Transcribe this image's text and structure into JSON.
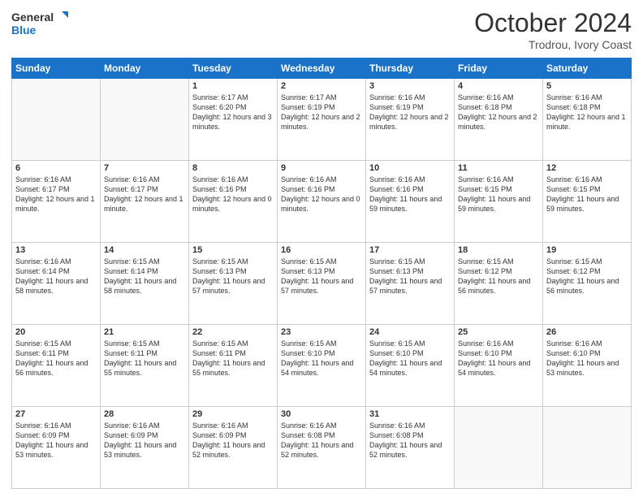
{
  "logo": {
    "line1": "General",
    "line2": "Blue"
  },
  "header": {
    "month": "October 2024",
    "location": "Trodrou, Ivory Coast"
  },
  "days_of_week": [
    "Sunday",
    "Monday",
    "Tuesday",
    "Wednesday",
    "Thursday",
    "Friday",
    "Saturday"
  ],
  "weeks": [
    [
      {
        "day": "",
        "empty": true
      },
      {
        "day": "",
        "empty": true
      },
      {
        "day": "1",
        "sunrise": "6:17 AM",
        "sunset": "6:20 PM",
        "daylight": "12 hours and 3 minutes."
      },
      {
        "day": "2",
        "sunrise": "6:17 AM",
        "sunset": "6:19 PM",
        "daylight": "12 hours and 2 minutes."
      },
      {
        "day": "3",
        "sunrise": "6:16 AM",
        "sunset": "6:19 PM",
        "daylight": "12 hours and 2 minutes."
      },
      {
        "day": "4",
        "sunrise": "6:16 AM",
        "sunset": "6:18 PM",
        "daylight": "12 hours and 2 minutes."
      },
      {
        "day": "5",
        "sunrise": "6:16 AM",
        "sunset": "6:18 PM",
        "daylight": "12 hours and 1 minute."
      }
    ],
    [
      {
        "day": "6",
        "sunrise": "6:16 AM",
        "sunset": "6:17 PM",
        "daylight": "12 hours and 1 minute."
      },
      {
        "day": "7",
        "sunrise": "6:16 AM",
        "sunset": "6:17 PM",
        "daylight": "12 hours and 1 minute."
      },
      {
        "day": "8",
        "sunrise": "6:16 AM",
        "sunset": "6:16 PM",
        "daylight": "12 hours and 0 minutes."
      },
      {
        "day": "9",
        "sunrise": "6:16 AM",
        "sunset": "6:16 PM",
        "daylight": "12 hours and 0 minutes."
      },
      {
        "day": "10",
        "sunrise": "6:16 AM",
        "sunset": "6:16 PM",
        "daylight": "11 hours and 59 minutes."
      },
      {
        "day": "11",
        "sunrise": "6:16 AM",
        "sunset": "6:15 PM",
        "daylight": "11 hours and 59 minutes."
      },
      {
        "day": "12",
        "sunrise": "6:16 AM",
        "sunset": "6:15 PM",
        "daylight": "11 hours and 59 minutes."
      }
    ],
    [
      {
        "day": "13",
        "sunrise": "6:16 AM",
        "sunset": "6:14 PM",
        "daylight": "11 hours and 58 minutes."
      },
      {
        "day": "14",
        "sunrise": "6:15 AM",
        "sunset": "6:14 PM",
        "daylight": "11 hours and 58 minutes."
      },
      {
        "day": "15",
        "sunrise": "6:15 AM",
        "sunset": "6:13 PM",
        "daylight": "11 hours and 57 minutes."
      },
      {
        "day": "16",
        "sunrise": "6:15 AM",
        "sunset": "6:13 PM",
        "daylight": "11 hours and 57 minutes."
      },
      {
        "day": "17",
        "sunrise": "6:15 AM",
        "sunset": "6:13 PM",
        "daylight": "11 hours and 57 minutes."
      },
      {
        "day": "18",
        "sunrise": "6:15 AM",
        "sunset": "6:12 PM",
        "daylight": "11 hours and 56 minutes."
      },
      {
        "day": "19",
        "sunrise": "6:15 AM",
        "sunset": "6:12 PM",
        "daylight": "11 hours and 56 minutes."
      }
    ],
    [
      {
        "day": "20",
        "sunrise": "6:15 AM",
        "sunset": "6:11 PM",
        "daylight": "11 hours and 56 minutes."
      },
      {
        "day": "21",
        "sunrise": "6:15 AM",
        "sunset": "6:11 PM",
        "daylight": "11 hours and 55 minutes."
      },
      {
        "day": "22",
        "sunrise": "6:15 AM",
        "sunset": "6:11 PM",
        "daylight": "11 hours and 55 minutes."
      },
      {
        "day": "23",
        "sunrise": "6:15 AM",
        "sunset": "6:10 PM",
        "daylight": "11 hours and 54 minutes."
      },
      {
        "day": "24",
        "sunrise": "6:15 AM",
        "sunset": "6:10 PM",
        "daylight": "11 hours and 54 minutes."
      },
      {
        "day": "25",
        "sunrise": "6:16 AM",
        "sunset": "6:10 PM",
        "daylight": "11 hours and 54 minutes."
      },
      {
        "day": "26",
        "sunrise": "6:16 AM",
        "sunset": "6:10 PM",
        "daylight": "11 hours and 53 minutes."
      }
    ],
    [
      {
        "day": "27",
        "sunrise": "6:16 AM",
        "sunset": "6:09 PM",
        "daylight": "11 hours and 53 minutes."
      },
      {
        "day": "28",
        "sunrise": "6:16 AM",
        "sunset": "6:09 PM",
        "daylight": "11 hours and 53 minutes."
      },
      {
        "day": "29",
        "sunrise": "6:16 AM",
        "sunset": "6:09 PM",
        "daylight": "11 hours and 52 minutes."
      },
      {
        "day": "30",
        "sunrise": "6:16 AM",
        "sunset": "6:08 PM",
        "daylight": "11 hours and 52 minutes."
      },
      {
        "day": "31",
        "sunrise": "6:16 AM",
        "sunset": "6:08 PM",
        "daylight": "11 hours and 52 minutes."
      },
      {
        "day": "",
        "empty": true
      },
      {
        "day": "",
        "empty": true
      }
    ]
  ],
  "labels": {
    "sunrise_prefix": "Sunrise: ",
    "sunset_prefix": "Sunset: ",
    "daylight_prefix": "Daylight: "
  }
}
